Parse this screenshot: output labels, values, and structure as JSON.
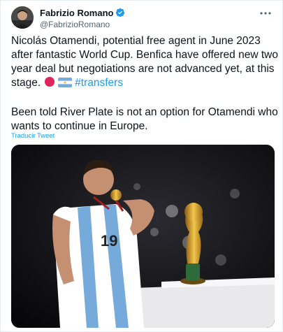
{
  "author": {
    "name": "Fabrizio Romano",
    "handle": "@FabrizioRomano",
    "verified": true
  },
  "tweet": {
    "paragraph1": "Nicolás Otamendi, potential free agent in June 2023 after fantastic World Cup. Benfica have offered new two year deal but negotiations are not advanced yet, at this stage.",
    "hashtag": "#transfers",
    "paragraph2": "Been told River Plate is not an option for Otamendi who wants to continue in Europe.",
    "translate_label": "Traducir Tweet",
    "emojis": [
      "red-circle-emoji",
      "argentina-flag-emoji"
    ]
  },
  "media": {
    "icon": "photo-player-kissing-medal-with-world-cup-trophy",
    "jersey_number": "19"
  },
  "colors": {
    "accent": "#1d9bf0",
    "text": "#0f1419",
    "secondary": "#536471"
  }
}
